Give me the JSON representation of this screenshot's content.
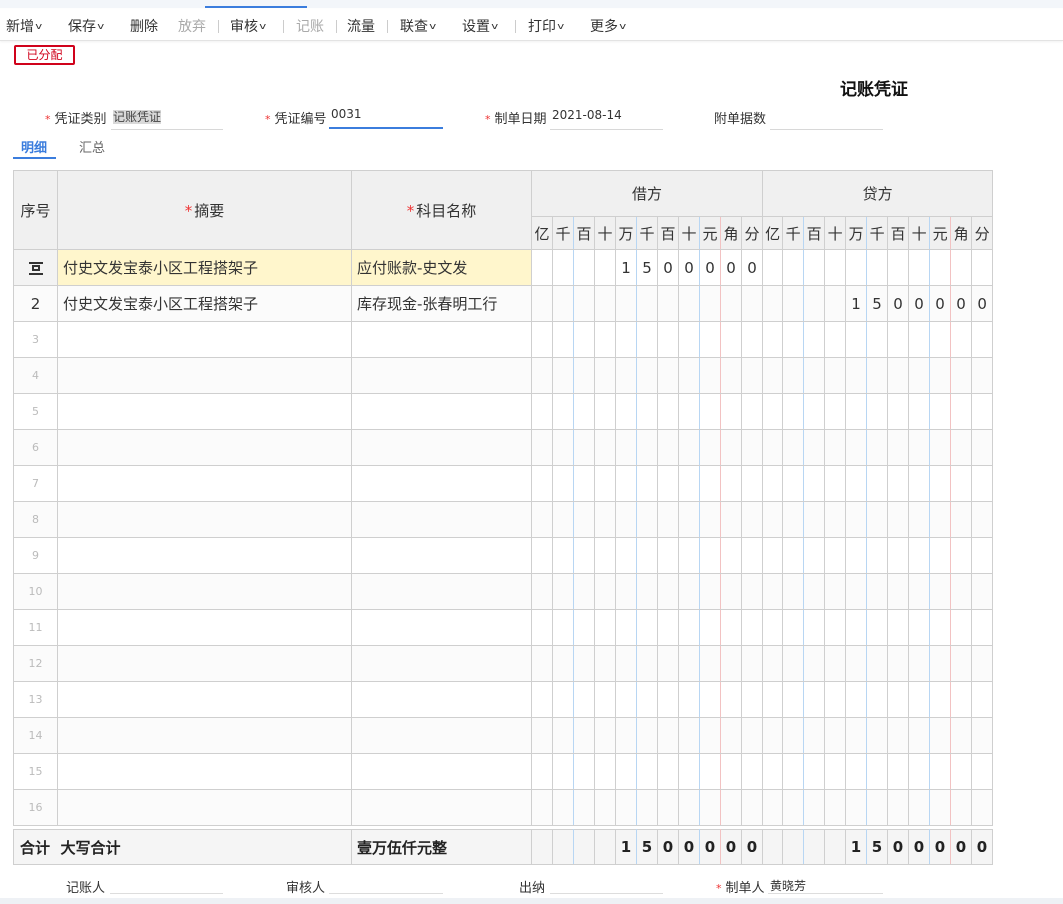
{
  "toolbar": {
    "new": "新增",
    "save": "保存",
    "delete": "删除",
    "discard": "放弃",
    "audit": "审核",
    "post": "记账",
    "flow": "流量",
    "query": "联查",
    "settings": "设置",
    "print": "打印",
    "more": "更多"
  },
  "status": "已分配",
  "title": "记账凭证",
  "fields": {
    "type_label": "凭证类别",
    "type_value": "记账凭证",
    "no_label": "凭证编号",
    "no_value": "0031",
    "date_label": "制单日期",
    "date_value": "2021-08-14",
    "attach_label": "附单据数",
    "attach_value": ""
  },
  "subtabs": {
    "detail": "明细",
    "summary": "汇总"
  },
  "table": {
    "seq": "序号",
    "summary": "摘要",
    "account": "科目名称",
    "debit": "借方",
    "credit": "贷方",
    "units": [
      "亿",
      "千",
      "百",
      "十",
      "万",
      "千",
      "百",
      "十",
      "元",
      "角",
      "分"
    ],
    "rows": [
      {
        "no": "",
        "summary": "付史文发宝泰小区工程搭架子",
        "account": "应付账款-史文发",
        "debit": [
          "",
          "",
          "",
          "",
          "1",
          "5",
          "0",
          "0",
          "0",
          "0",
          "0"
        ],
        "credit": [
          "",
          "",
          "",
          "",
          "",
          "",
          "",
          "",
          "",
          "",
          ""
        ]
      },
      {
        "no": "2",
        "summary": "付史文发宝泰小区工程搭架子",
        "account": "库存现金-张春明工行",
        "debit": [
          "",
          "",
          "",
          "",
          "",
          "",
          "",
          "",
          "",
          "",
          ""
        ],
        "credit": [
          "",
          "",
          "",
          "",
          "1",
          "5",
          "0",
          "0",
          "0",
          "0",
          "0"
        ]
      },
      {
        "no": "3",
        "summary": "",
        "account": "",
        "debit": [
          "",
          "",
          "",
          "",
          "",
          "",
          "",
          "",
          "",
          "",
          ""
        ],
        "credit": [
          "",
          "",
          "",
          "",
          "",
          "",
          "",
          "",
          "",
          "",
          ""
        ]
      },
      {
        "no": "4",
        "summary": "",
        "account": "",
        "debit": [
          "",
          "",
          "",
          "",
          "",
          "",
          "",
          "",
          "",
          "",
          ""
        ],
        "credit": [
          "",
          "",
          "",
          "",
          "",
          "",
          "",
          "",
          "",
          "",
          ""
        ]
      },
      {
        "no": "5",
        "summary": "",
        "account": "",
        "debit": [
          "",
          "",
          "",
          "",
          "",
          "",
          "",
          "",
          "",
          "",
          ""
        ],
        "credit": [
          "",
          "",
          "",
          "",
          "",
          "",
          "",
          "",
          "",
          "",
          ""
        ]
      },
      {
        "no": "6",
        "summary": "",
        "account": "",
        "debit": [
          "",
          "",
          "",
          "",
          "",
          "",
          "",
          "",
          "",
          "",
          ""
        ],
        "credit": [
          "",
          "",
          "",
          "",
          "",
          "",
          "",
          "",
          "",
          "",
          ""
        ]
      },
      {
        "no": "7",
        "summary": "",
        "account": "",
        "debit": [
          "",
          "",
          "",
          "",
          "",
          "",
          "",
          "",
          "",
          "",
          ""
        ],
        "credit": [
          "",
          "",
          "",
          "",
          "",
          "",
          "",
          "",
          "",
          "",
          ""
        ]
      },
      {
        "no": "8",
        "summary": "",
        "account": "",
        "debit": [
          "",
          "",
          "",
          "",
          "",
          "",
          "",
          "",
          "",
          "",
          ""
        ],
        "credit": [
          "",
          "",
          "",
          "",
          "",
          "",
          "",
          "",
          "",
          "",
          ""
        ]
      },
      {
        "no": "9",
        "summary": "",
        "account": "",
        "debit": [
          "",
          "",
          "",
          "",
          "",
          "",
          "",
          "",
          "",
          "",
          ""
        ],
        "credit": [
          "",
          "",
          "",
          "",
          "",
          "",
          "",
          "",
          "",
          "",
          ""
        ]
      },
      {
        "no": "10",
        "summary": "",
        "account": "",
        "debit": [
          "",
          "",
          "",
          "",
          "",
          "",
          "",
          "",
          "",
          "",
          ""
        ],
        "credit": [
          "",
          "",
          "",
          "",
          "",
          "",
          "",
          "",
          "",
          "",
          ""
        ]
      },
      {
        "no": "11",
        "summary": "",
        "account": "",
        "debit": [
          "",
          "",
          "",
          "",
          "",
          "",
          "",
          "",
          "",
          "",
          ""
        ],
        "credit": [
          "",
          "",
          "",
          "",
          "",
          "",
          "",
          "",
          "",
          "",
          ""
        ]
      },
      {
        "no": "12",
        "summary": "",
        "account": "",
        "debit": [
          "",
          "",
          "",
          "",
          "",
          "",
          "",
          "",
          "",
          "",
          ""
        ],
        "credit": [
          "",
          "",
          "",
          "",
          "",
          "",
          "",
          "",
          "",
          "",
          ""
        ]
      },
      {
        "no": "13",
        "summary": "",
        "account": "",
        "debit": [
          "",
          "",
          "",
          "",
          "",
          "",
          "",
          "",
          "",
          "",
          ""
        ],
        "credit": [
          "",
          "",
          "",
          "",
          "",
          "",
          "",
          "",
          "",
          "",
          ""
        ]
      },
      {
        "no": "14",
        "summary": "",
        "account": "",
        "debit": [
          "",
          "",
          "",
          "",
          "",
          "",
          "",
          "",
          "",
          "",
          ""
        ],
        "credit": [
          "",
          "",
          "",
          "",
          "",
          "",
          "",
          "",
          "",
          "",
          ""
        ]
      },
      {
        "no": "15",
        "summary": "",
        "account": "",
        "debit": [
          "",
          "",
          "",
          "",
          "",
          "",
          "",
          "",
          "",
          "",
          ""
        ],
        "credit": [
          "",
          "",
          "",
          "",
          "",
          "",
          "",
          "",
          "",
          "",
          ""
        ]
      },
      {
        "no": "16",
        "summary": "",
        "account": "",
        "debit": [
          "",
          "",
          "",
          "",
          "",
          "",
          "",
          "",
          "",
          "",
          ""
        ],
        "credit": [
          "",
          "",
          "",
          "",
          "",
          "",
          "",
          "",
          "",
          "",
          ""
        ]
      }
    ]
  },
  "totals": {
    "label": "合计",
    "capital_label": "大写合计",
    "capital_value": "壹万伍仟元整",
    "debit": [
      "",
      "",
      "",
      "",
      "1",
      "5",
      "0",
      "0",
      "0",
      "0",
      "0"
    ],
    "credit": [
      "",
      "",
      "",
      "",
      "1",
      "5",
      "0",
      "0",
      "0",
      "0",
      "0"
    ]
  },
  "signatures": {
    "bookkeeper_label": "记账人",
    "bookkeeper": "",
    "auditor_label": "审核人",
    "auditor": "",
    "cashier_label": "出纳",
    "cashier": "",
    "maker_label": "制单人",
    "maker": "黄晓芳"
  }
}
